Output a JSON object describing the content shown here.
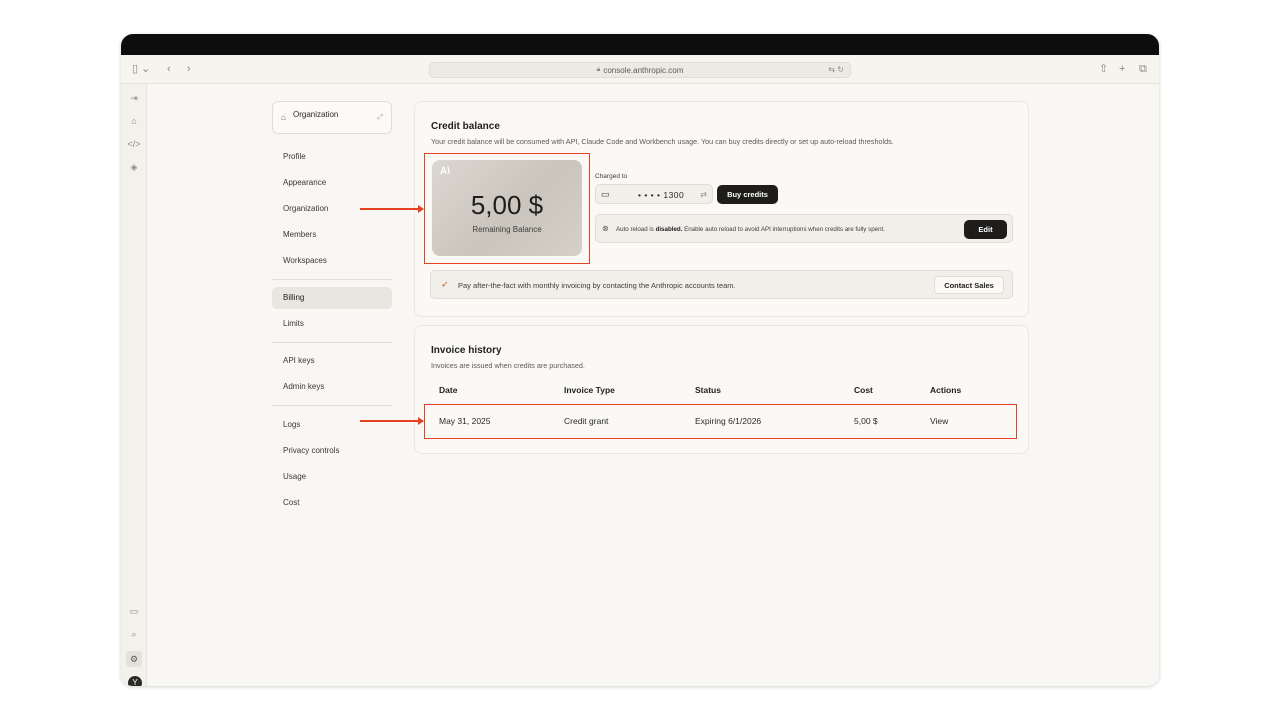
{
  "browser": {
    "url": "console.anthropic.com",
    "sidebar_toggle_icon": "sidebar-icon",
    "back_icon": "chevron-left-icon",
    "forward_icon": "chevron-right-icon",
    "share_icon": "share-icon",
    "new_tab_icon": "plus-icon",
    "tabs_icon": "tabs-icon"
  },
  "rail": {
    "items": [
      "collapse-icon",
      "home-icon",
      "code-icon",
      "layers-icon"
    ],
    "bottom": [
      "book-icon",
      "search-icon",
      "gear-icon"
    ],
    "avatar": "Y"
  },
  "org_selector": {
    "label": "Organization"
  },
  "nav": {
    "profile": "Profile",
    "appearance": "Appearance",
    "organization": "Organization",
    "members": "Members",
    "workspaces": "Workspaces",
    "billing": "Billing",
    "limits": "Limits",
    "api_keys": "API keys",
    "admin_keys": "Admin keys",
    "logs": "Logs",
    "privacy_controls": "Privacy controls",
    "usage": "Usage",
    "cost": "Cost"
  },
  "credit": {
    "title": "Credit balance",
    "description": "Your credit balance will be consumed with API, Claude Code and Workbench usage. You can buy credits directly or set up auto-reload thresholds.",
    "logo": "A\\",
    "amount": "5,00 $",
    "amount_label": "Remaining Balance",
    "charged_to_label": "Charged to",
    "card_number": "• • • • 1300",
    "buy_button": "Buy credits",
    "auto_reload_prefix": "Auto reload is ",
    "auto_reload_state": "disabled.",
    "auto_reload_suffix": " Enable auto reload to avoid API interruptions when credits are fully spent.",
    "edit_button": "Edit",
    "sales_text": "Pay after-the-fact with monthly invoicing by contacting the Anthropic accounts team.",
    "contact_button": "Contact Sales"
  },
  "invoices": {
    "title": "Invoice history",
    "description": "Invoices are issued when credits are purchased.",
    "columns": [
      "Date",
      "Invoice Type",
      "Status",
      "Cost",
      "Actions"
    ],
    "rows": [
      {
        "date": "May 31, 2025",
        "type": "Credit grant",
        "status": "Expiring 6/1/2026",
        "cost": "5,00 $",
        "action": "View"
      }
    ]
  },
  "colors": {
    "annotation": "#e5431f",
    "accent_dark": "#1e1d1b",
    "background": "#f9f7f3"
  }
}
